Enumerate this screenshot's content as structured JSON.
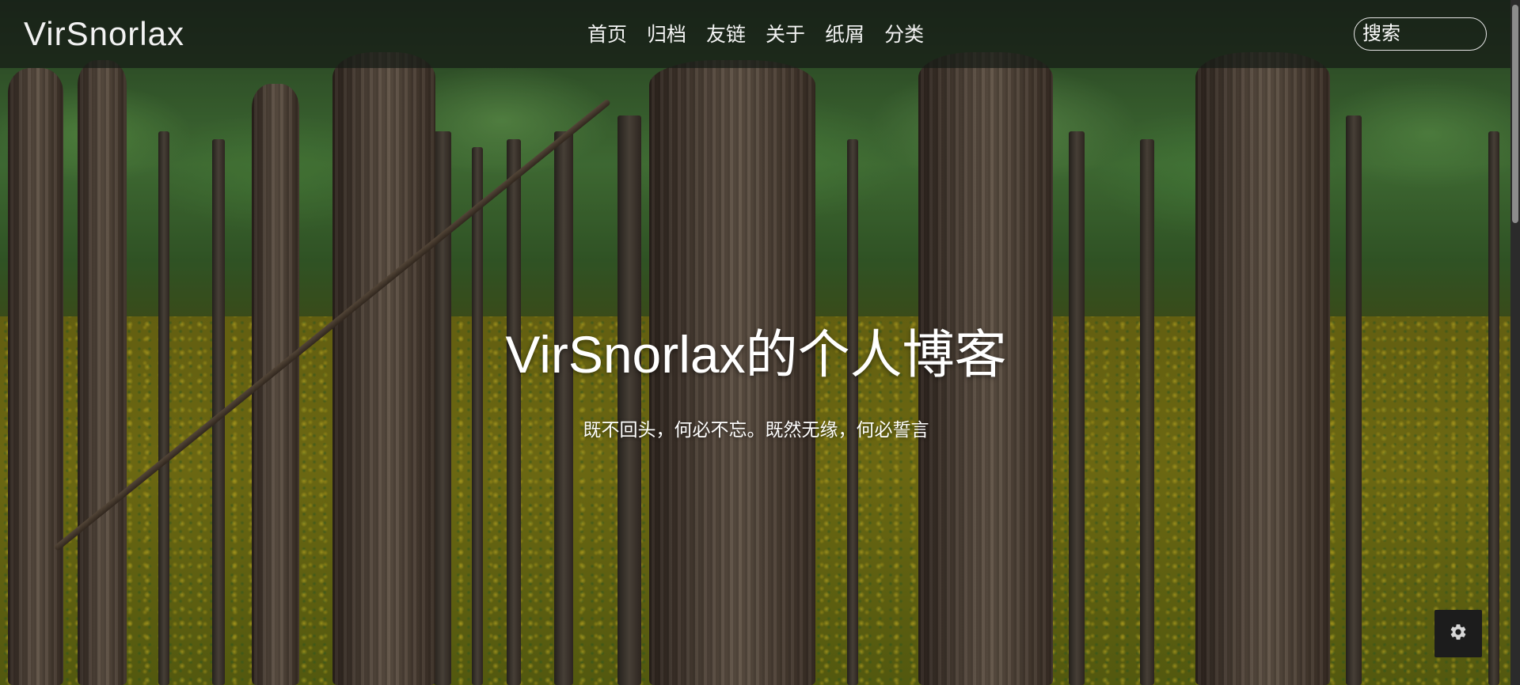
{
  "header": {
    "brand": "VirSnorlax",
    "nav": [
      {
        "label": "首页",
        "key": "home"
      },
      {
        "label": "归档",
        "key": "archive"
      },
      {
        "label": "友链",
        "key": "links"
      },
      {
        "label": "关于",
        "key": "about"
      },
      {
        "label": "纸屑",
        "key": "notes"
      },
      {
        "label": "分类",
        "key": "categories"
      }
    ],
    "search": {
      "placeholder": "搜索",
      "value": ""
    }
  },
  "hero": {
    "title": "VirSnorlax的个人博客",
    "subtitle": "既不回头，何必不忘。既然无缘，何必誓言"
  },
  "floating": {
    "settings_icon": "gear-icon"
  },
  "colors": {
    "header_bg": "#1c1c1c",
    "text": "#ffffff",
    "settings_bg": "#1c1c1c"
  }
}
